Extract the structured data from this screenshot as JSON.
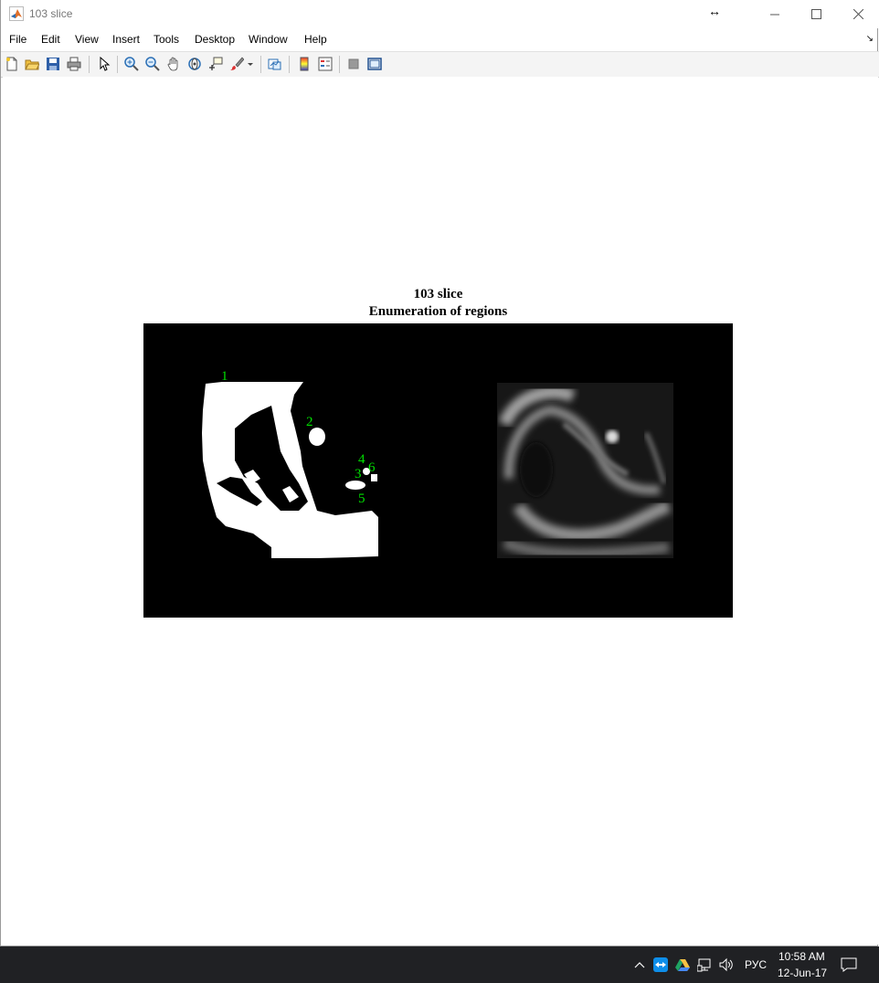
{
  "window": {
    "title": "103 slice",
    "controls": {
      "resize_cursor": "↔",
      "minimize": "—",
      "maximize": "☐",
      "close": "✕"
    }
  },
  "menu": {
    "items": [
      "File",
      "Edit",
      "View",
      "Insert",
      "Tools",
      "Desktop",
      "Window",
      "Help"
    ],
    "corner_glyph": "↘"
  },
  "toolbar": {
    "icons": [
      "new-figure-icon",
      "open-icon",
      "save-icon",
      "print-icon",
      "pointer-icon",
      "zoom-in-icon",
      "zoom-out-icon",
      "pan-icon",
      "rotate-3d-icon",
      "data-cursor-icon",
      "brush-icon",
      "link-plot-icon",
      "colorbar-icon",
      "legend-icon",
      "hide-plot-tools-icon",
      "show-plot-tools-icon"
    ]
  },
  "figure": {
    "title_line1": "103 slice",
    "title_line2": "Enumeration of regions",
    "region_labels": [
      "1",
      "2",
      "3",
      "4",
      "5",
      "6"
    ],
    "label_color": "#00e000"
  },
  "taskbar": {
    "language": "РУС",
    "time": "10:58 AM",
    "date": "12-Jun-17",
    "tray_icons": [
      "chevron-up-icon",
      "teamviewer-icon",
      "google-drive-icon",
      "network-icon",
      "volume-icon",
      "notification-icon"
    ]
  }
}
